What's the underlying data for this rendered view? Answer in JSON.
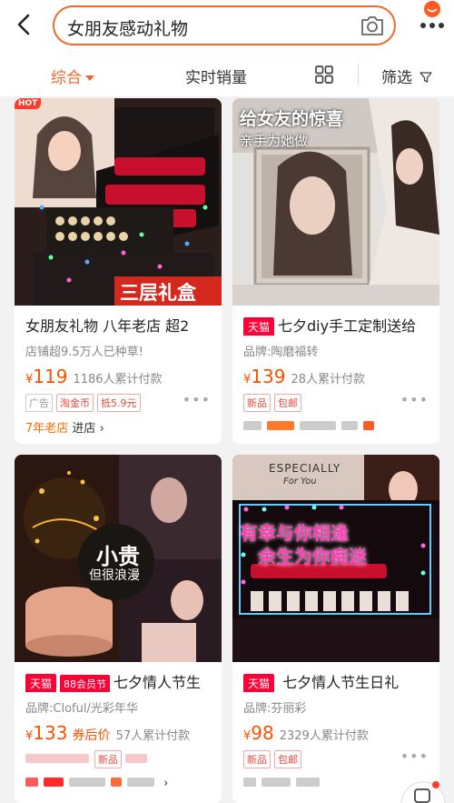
{
  "search": {
    "query": "女朋友感动礼物"
  },
  "sort": {
    "comprehensive": "综合",
    "realtime_sales": "实时销量",
    "filter": "筛选"
  },
  "products": [
    {
      "title": "女朋友礼物 八年老店 超2",
      "subtitle": "店铺超9.5万人已种草!",
      "currency": "¥",
      "price": "119",
      "sold": "1186人累计付款",
      "tags": [
        "广告",
        "淘金币",
        "抵5.9元"
      ],
      "store_badge": "7年老店",
      "store_link": "进店",
      "image_text": "三层礼盒",
      "hot": "HOT"
    },
    {
      "brand_tag": "天猫",
      "title": "七夕diy手工定制送给",
      "subtitle": "品牌:陶磨福转",
      "currency": "¥",
      "price": "139",
      "sold": "28人累计付款",
      "tags": [
        "新品",
        "包邮"
      ],
      "image_text_1": "给女友的惊喜",
      "image_text_2": "亲手为她做"
    },
    {
      "brand_tag": "天猫",
      "brand_tag_2": "88会员节",
      "title": "七夕情人节生",
      "subtitle": "品牌:Cloful/光彩年华",
      "currency": "¥",
      "price": "133",
      "price_note": "券后价",
      "sold": "57人累计付款",
      "tags": [
        "新品"
      ],
      "image_text_1": "小贵",
      "image_text_2": "但很浪漫"
    },
    {
      "brand_tag": "天猫",
      "title": "七夕情人节生日礼",
      "subtitle": "品牌:芬丽彩",
      "currency": "¥",
      "price": "98",
      "sold": "2329人累计付款",
      "tags": [
        "新品",
        "包邮"
      ],
      "image_text_1": "ESPECIALLY",
      "image_text_2": "For You",
      "image_text_3": "有幸与你相逢",
      "image_text_4": "余生为你痴迷"
    }
  ],
  "colors": {
    "accent": "#f2672a",
    "price": "#ff4f00",
    "tmall": "#ff0036"
  }
}
